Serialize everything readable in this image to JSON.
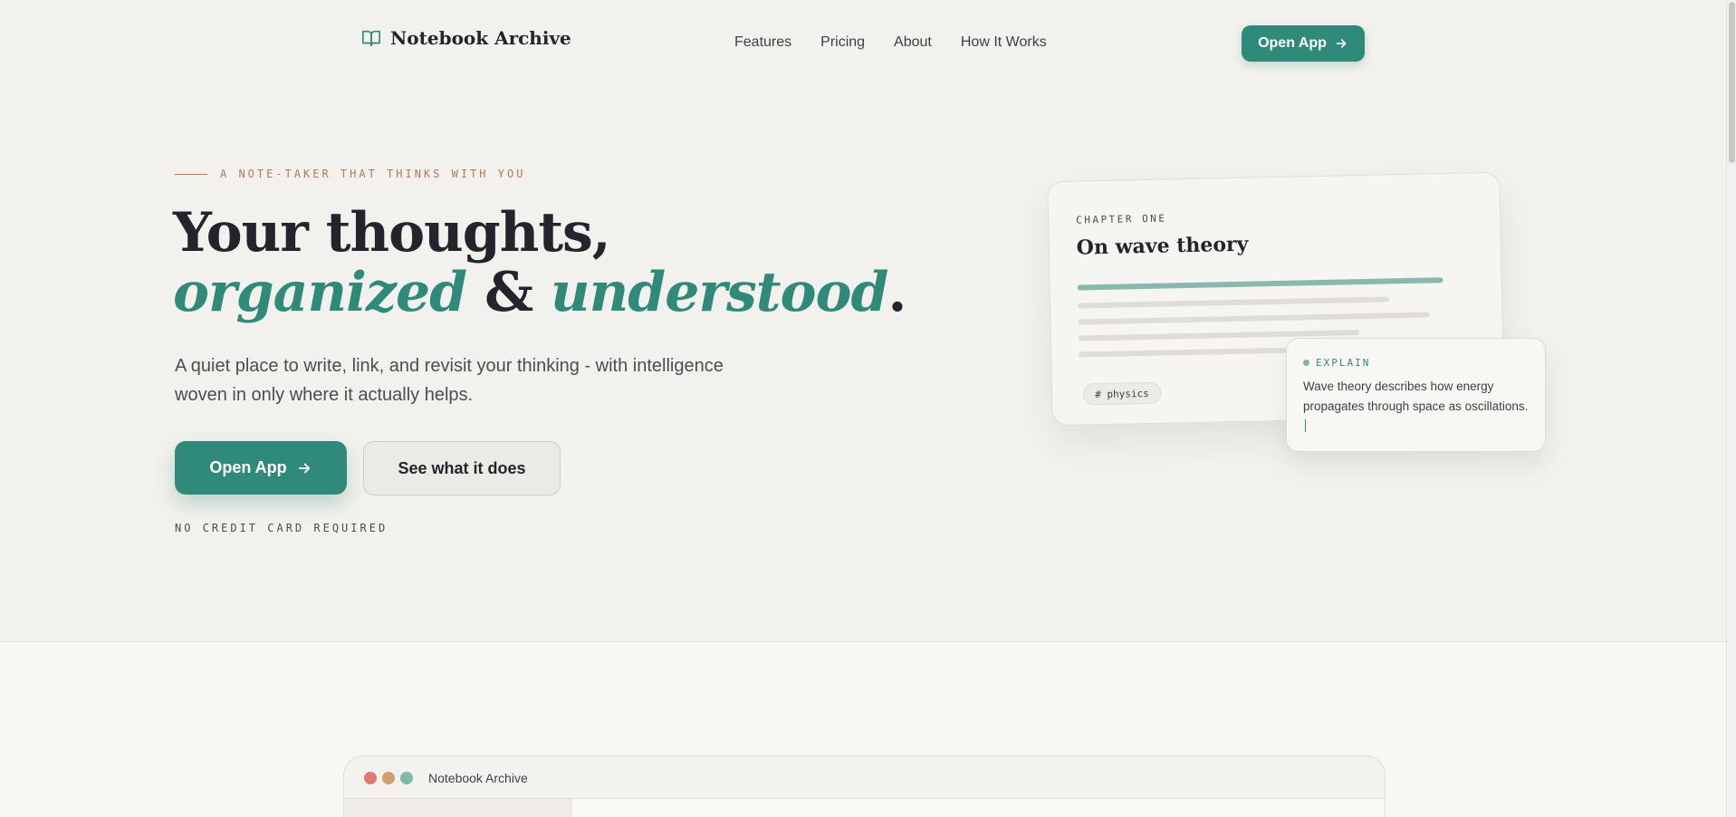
{
  "header": {
    "brand": "Notebook Archive",
    "nav": [
      "Features",
      "Pricing",
      "About",
      "How It Works"
    ],
    "cta": "Open App"
  },
  "hero": {
    "eyebrow": "A NOTE-TAKER THAT THINKS WITH YOU",
    "title_line1": "Your thoughts,",
    "title_accent1": "organized",
    "title_amp": "&",
    "title_accent2": "understood",
    "title_period": ".",
    "lede": "A quiet place to write, link, and revisit your thinking - with intelligence woven in only where it actually helps.",
    "primary_button": "Open App",
    "secondary_button": "See what it does",
    "footnote": "NO CREDIT CARD REQUIRED"
  },
  "card": {
    "eyebrow": "CHAPTER ONE",
    "title": "On wave theory",
    "tag": "# physics"
  },
  "popup": {
    "label": "EXPLAIN",
    "text": "Wave theory describes how energy propagates through space as oscillations."
  },
  "preview_window": {
    "title": "Notebook Archive"
  },
  "colors": {
    "accent": "#2f8a79",
    "eyebrow": "#b27a56",
    "background": "#f3f1ed",
    "traffic_red": "#e07a72",
    "traffic_yellow": "#d0a070",
    "traffic_green": "#7fb8aa"
  }
}
